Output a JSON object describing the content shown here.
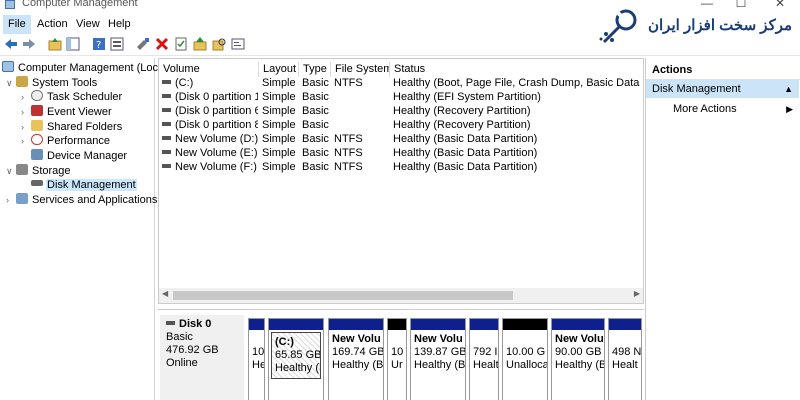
{
  "window": {
    "title": "Computer Management",
    "minimize": "—",
    "maximize": "☐",
    "close": "✕"
  },
  "menu": [
    {
      "label": "File"
    },
    {
      "label": "Action"
    },
    {
      "label": "View"
    },
    {
      "label": "Help"
    }
  ],
  "logo": {
    "text": "مرکز سخت افزار ایران"
  },
  "tree": {
    "root": "Computer Management (Local)",
    "system_tools": "System Tools",
    "task_scheduler": "Task Scheduler",
    "event_viewer": "Event Viewer",
    "shared_folders": "Shared Folders",
    "performance": "Performance",
    "device_manager": "Device Manager",
    "storage": "Storage",
    "disk_management": "Disk Management",
    "services": "Services and Applications"
  },
  "volume_table": {
    "columns": [
      "Volume",
      "Layout",
      "Type",
      "File System",
      "Status"
    ],
    "rows": [
      {
        "volume": "(C:)",
        "layout": "Simple",
        "type": "Basic",
        "fs": "NTFS",
        "status": "Healthy (Boot, Page File, Crash Dump, Basic Data Partition"
      },
      {
        "volume": "(Disk 0 partition 1)",
        "layout": "Simple",
        "type": "Basic",
        "fs": "",
        "status": "Healthy (EFI System Partition)"
      },
      {
        "volume": "(Disk 0 partition 6)",
        "layout": "Simple",
        "type": "Basic",
        "fs": "",
        "status": "Healthy (Recovery Partition)"
      },
      {
        "volume": "(Disk 0 partition 8)",
        "layout": "Simple",
        "type": "Basic",
        "fs": "",
        "status": "Healthy (Recovery Partition)"
      },
      {
        "volume": "New Volume (D:)",
        "layout": "Simple",
        "type": "Basic",
        "fs": "NTFS",
        "status": "Healthy (Basic Data Partition)"
      },
      {
        "volume": "New Volume (E:)",
        "layout": "Simple",
        "type": "Basic",
        "fs": "NTFS",
        "status": "Healthy (Basic Data Partition)"
      },
      {
        "volume": "New Volume (F:)",
        "layout": "Simple",
        "type": "Basic",
        "fs": "NTFS",
        "status": "Healthy (Basic Data Partition)"
      }
    ]
  },
  "disk": {
    "name": "Disk 0",
    "type": "Basic",
    "size": "476.92 GB",
    "state": "Online",
    "partitions": [
      {
        "l1": "10",
        "l2": "He"
      },
      {
        "name": "(C:)",
        "l1": "65.85 GB I",
        "l2": "Healthy (E"
      },
      {
        "name": "New Volu",
        "l1": "169.74 GB",
        "l2": "Healthy (Ba"
      },
      {
        "l1": "10",
        "l2": "Ur"
      },
      {
        "name": "New Volu",
        "l1": "139.87 GB",
        "l2": "Healthy (Ba"
      },
      {
        "l1": "792 I",
        "l2": "Healt"
      },
      {
        "l1": "10.00 G",
        "l2": "Unalloca"
      },
      {
        "name": "New Volu",
        "l1": "90.00 GB N",
        "l2": "Healthy (B"
      },
      {
        "l1": "498 N",
        "l2": "Healt"
      }
    ]
  },
  "actions": {
    "header": "Actions",
    "selected": "Disk Management",
    "more": "More Actions"
  }
}
